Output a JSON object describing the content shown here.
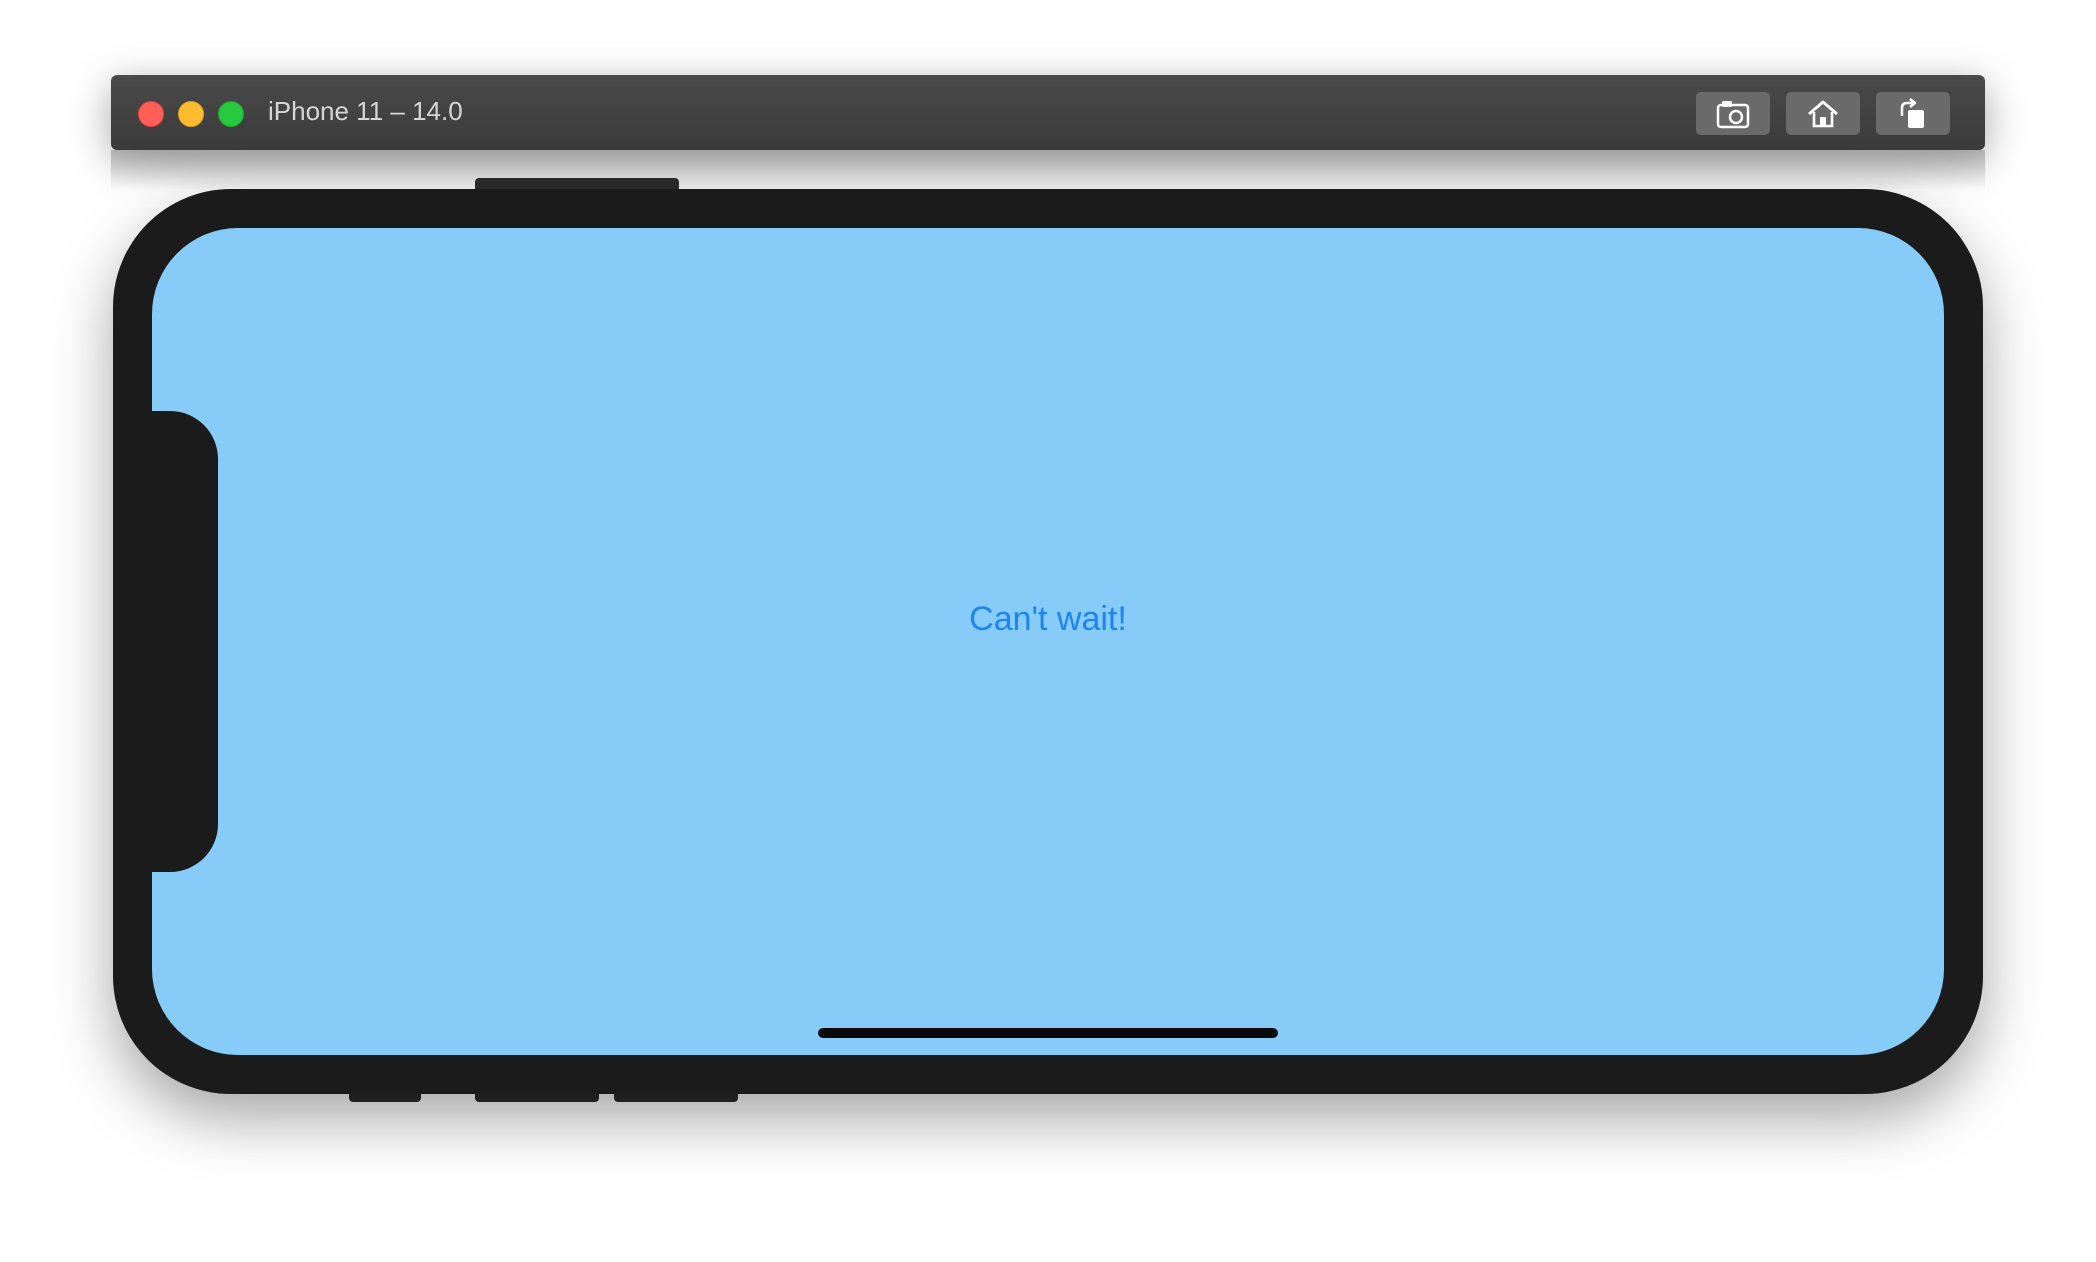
{
  "window": {
    "title": "iPhone 11 – 14.0"
  },
  "toolbar": {
    "buttons": [
      {
        "icon": "camera-icon",
        "name": "screenshot"
      },
      {
        "icon": "home-icon",
        "name": "home"
      },
      {
        "icon": "rotate-icon",
        "name": "rotate"
      }
    ]
  },
  "screen": {
    "text": "Can't wait!",
    "background": "#87ccf8",
    "text_color": "#1e84f2"
  }
}
